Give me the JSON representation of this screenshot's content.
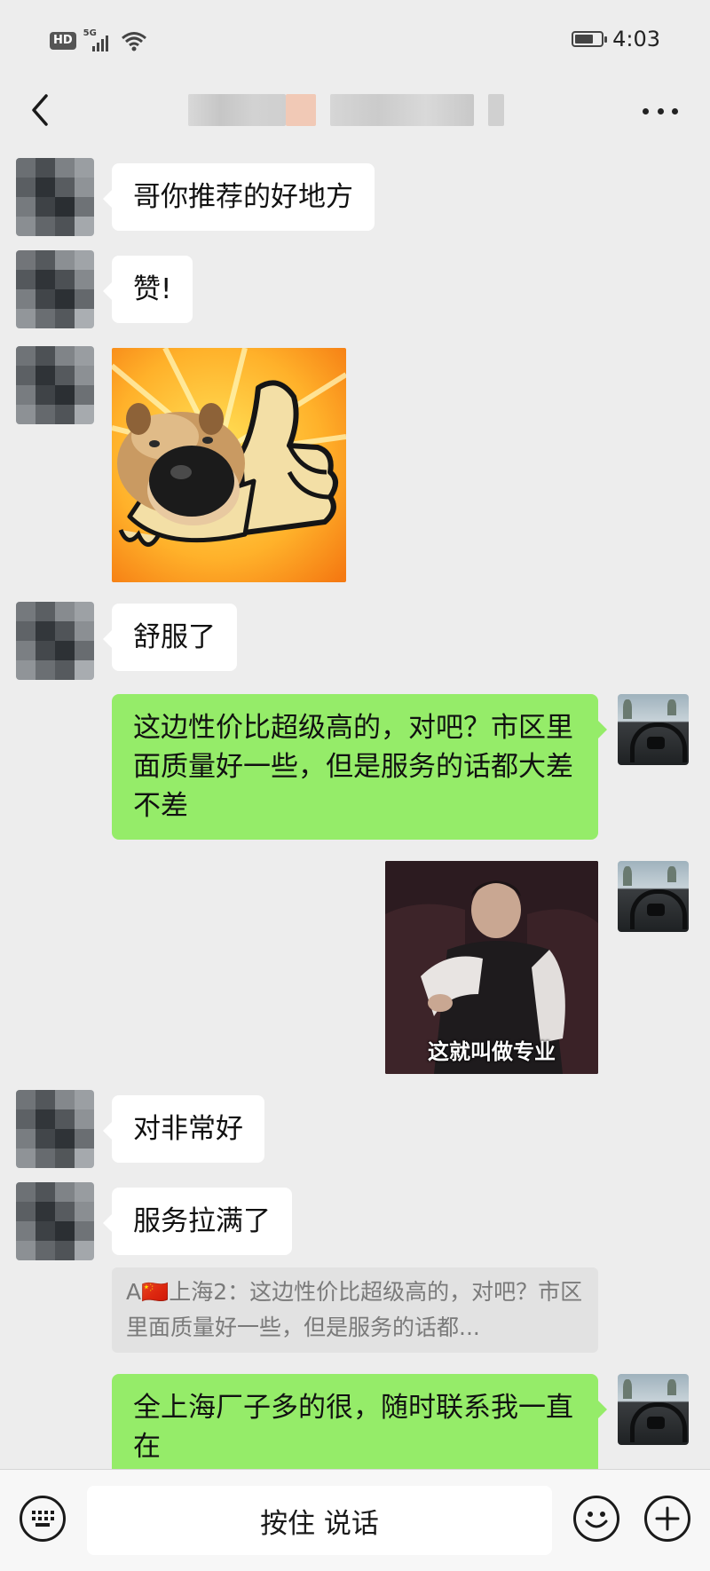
{
  "status_bar": {
    "hd": "HD",
    "network": "5G",
    "time": "4:03",
    "battery_level": 0.7
  },
  "header": {
    "back_icon": "chevron-left-icon",
    "more_icon": "more-horizontal-icon"
  },
  "messages": [
    {
      "from": "other",
      "type": "text",
      "text": "哥你推荐的好地方"
    },
    {
      "from": "other",
      "type": "text",
      "text": "赞!"
    },
    {
      "from": "other",
      "type": "sticker",
      "description_icon": "dog-thumbs-up-sticker"
    },
    {
      "from": "other",
      "type": "text",
      "text": "舒服了"
    },
    {
      "from": "me",
      "type": "text",
      "text": "这边性价比超级高的，对吧？市区里面质量好一些，但是服务的话都大差不差"
    },
    {
      "from": "me",
      "type": "sticker",
      "caption": "这就叫做专业"
    },
    {
      "from": "other",
      "type": "text",
      "text": "对非常好"
    },
    {
      "from": "other",
      "type": "text",
      "text": "服务拉满了",
      "quote": "A🇨🇳上海2：这边性价比超级高的，对吧？市区里面质量好一些，但是服务的话都..."
    },
    {
      "from": "me",
      "type": "text",
      "text": "全上海厂子多的很，随时联系我一直在"
    }
  ],
  "input_bar": {
    "keyboard_icon": "keyboard-icon",
    "voice_label": "按住 说话",
    "emoji_icon": "emoji-icon",
    "plus_icon": "plus-icon"
  },
  "colors": {
    "background": "#ededed",
    "bubble_in": "#ffffff",
    "bubble_out": "#95ec69"
  }
}
